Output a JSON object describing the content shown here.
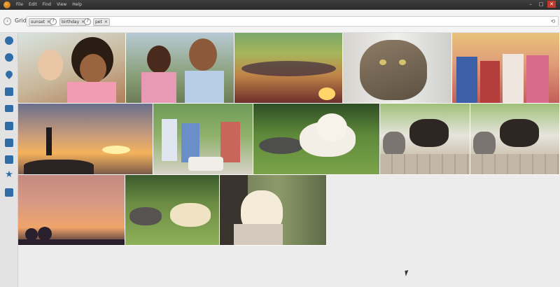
{
  "menu": [
    "File",
    "Edit",
    "Find",
    "View",
    "Help"
  ],
  "window_controls": {
    "minimize": "–",
    "maximize": "□",
    "close": "✕"
  },
  "filter": {
    "view_label": "Grid",
    "back_icon": "‹",
    "tags": [
      {
        "label": "sunset",
        "remove": "✕"
      },
      {
        "label": "birthday",
        "remove": "✕"
      },
      {
        "label": "pet",
        "remove": "✕"
      }
    ],
    "operators": [
      "f",
      "f"
    ],
    "clear_icon": "⟲"
  },
  "sidebar_icons": [
    "home-icon",
    "people-icon",
    "location-pin-icon",
    "calendar-icon",
    "folder-icon",
    "tag-icon",
    "album-icon",
    "edit-icon",
    "star-icon",
    "image-icon"
  ],
  "photos": [
    {
      "subject": "girls-portrait"
    },
    {
      "subject": "girls-bubbles"
    },
    {
      "subject": "sunset-clouds"
    },
    {
      "subject": "tabby-cat"
    },
    {
      "subject": "birthday-party-kids"
    },
    {
      "subject": "yoga-sunset"
    },
    {
      "subject": "birthday-cake-kids"
    },
    {
      "subject": "puppy-and-kitten"
    },
    {
      "subject": "kittens-and-dog"
    },
    {
      "subject": "kittens-and-dog"
    },
    {
      "subject": "purple-sunset-trees"
    },
    {
      "subject": "kitten-and-puppy-grass"
    },
    {
      "subject": "girl-with-puppy"
    }
  ]
}
